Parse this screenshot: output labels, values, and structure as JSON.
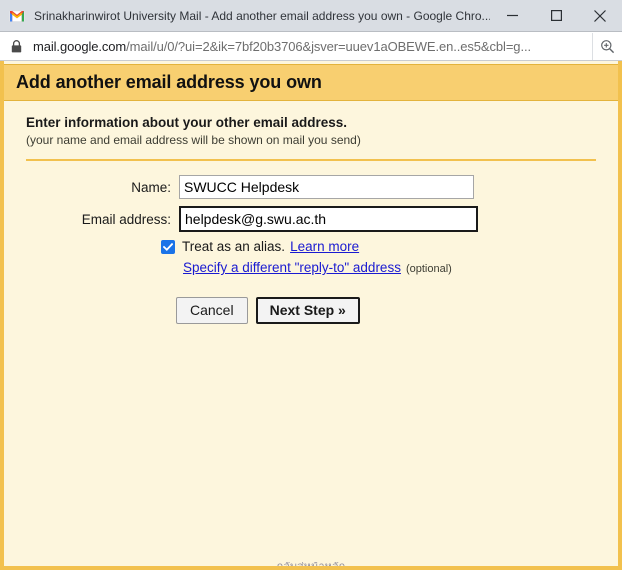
{
  "window": {
    "favicon": "gmail-logo-icon",
    "tab_title": "Srinakharinwirot University Mail - Add another email address you own - Google Chro...",
    "minimize_label": "—",
    "maximize_label": "□",
    "close_label": "×"
  },
  "omnibox": {
    "lock_icon": "lock-icon",
    "url_host": "mail.google.com",
    "url_path": "/mail/u/0/?ui=2&ik=7bf20b3706&jsver=uuev1aOBEWE.en..es5&cbl=g...",
    "zoom_icon": "zoom-in-icon"
  },
  "banner": {
    "title": "Add another email address you own",
    "bg_color": "#f8cf70",
    "border_color": "#e3b33c"
  },
  "section": {
    "heading": "Enter information about your other email address.",
    "subheading": "(your name and email address will be shown on mail you send)"
  },
  "form": {
    "name": {
      "label": "Name:",
      "value": "SWUCC Helpdesk",
      "placeholder": ""
    },
    "email": {
      "label": "Email address:",
      "value": "helpdesk@g.swu.ac.th",
      "placeholder": "",
      "focused": true
    },
    "alias": {
      "checked": true,
      "text": "Treat as an alias.",
      "learn_more_label": "Learn more"
    },
    "reply_to": {
      "link_label": "Specify a different \"reply-to\" address",
      "optional_label": "(optional)"
    }
  },
  "buttons": {
    "cancel_label": "Cancel",
    "next_label": "Next Step »"
  },
  "colors": {
    "page_bg": "#fdf6dd",
    "frame_gold": "#f2c14e",
    "link_blue": "#1a1ad1",
    "checkbox_blue": "#1a73e8",
    "titlebar_bg": "#d9dde3"
  },
  "bottom_partial_text": "กลับสู่หน้าหลัก"
}
